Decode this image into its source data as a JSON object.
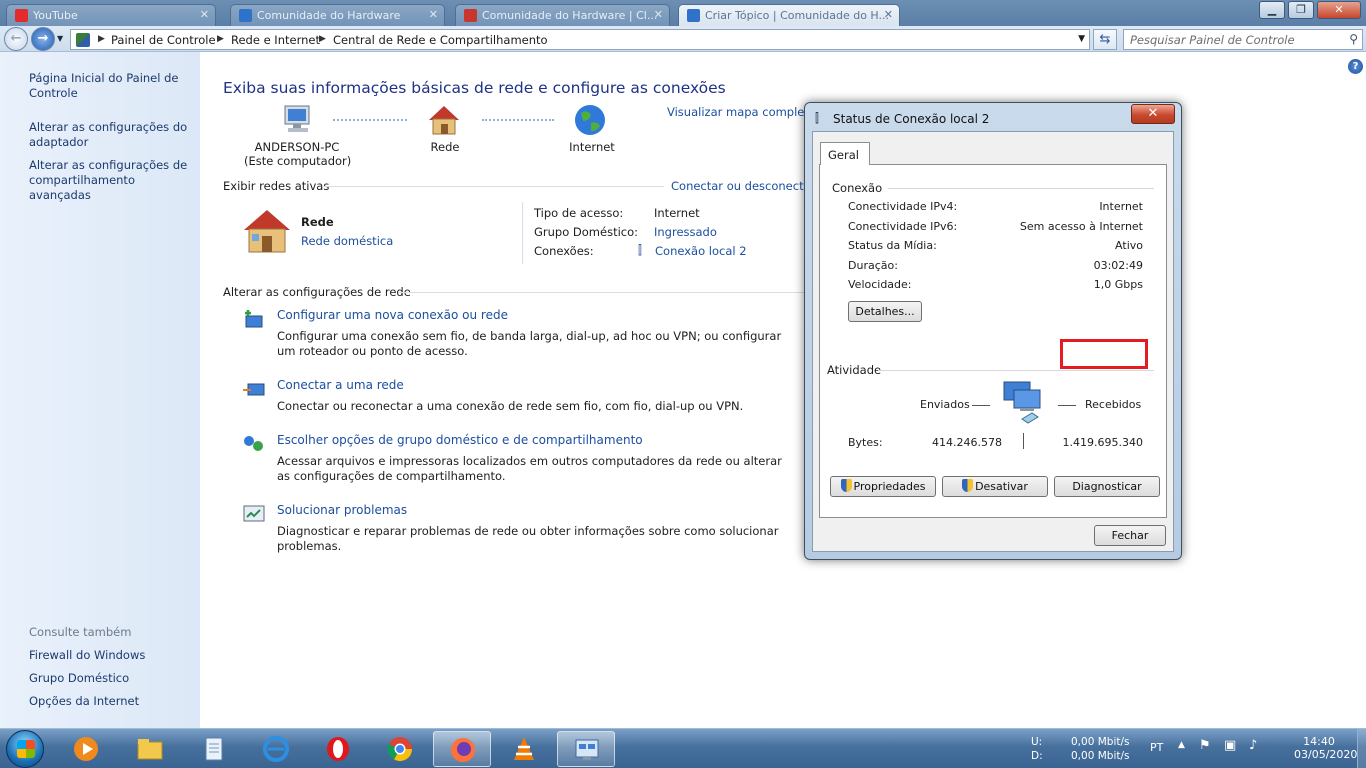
{
  "browser_tabs": [
    {
      "title": "YouTube",
      "icon_color": "#e32b2b"
    },
    {
      "title": "Comunidade do Hardware",
      "icon_color": "#2e72c9"
    },
    {
      "title": "Comunidade do Hardware | Cl...",
      "icon_color": "#c9362e"
    },
    {
      "title": "Criar Tópico | Comunidade do H...",
      "icon_color": "#2e72c9"
    }
  ],
  "address": {
    "breadcrumbs": [
      "Painel de Controle",
      "Rede e Internet",
      "Central de Rede e Compartilhamento"
    ],
    "search_placeholder": "Pesquisar Painel de Controle"
  },
  "left_pane": {
    "links": [
      "Página Inicial do Painel de Controle",
      "Alterar as configurações do adaptador",
      "Alterar as configurações de compartilhamento avançadas"
    ],
    "see_also_heading": "Consulte também",
    "see_also": [
      "Firewall do Windows",
      "Grupo Doméstico",
      "Opções da Internet"
    ]
  },
  "main": {
    "title": "Exiba suas informações básicas de rede e configure as conexões",
    "view_full_map": "Visualizar mapa completo",
    "map": {
      "computer_name": "ANDERSON-PC",
      "computer_sub": "(Este computador)",
      "network": "Rede",
      "internet": "Internet"
    },
    "active_networks_heading": "Exibir redes ativas",
    "connect_disconnect": "Conectar ou desconectar",
    "network_name": "Rede",
    "network_type": "Rede doméstica",
    "info": {
      "access_type_label": "Tipo de acesso:",
      "access_type_value": "Internet",
      "homegroup_label": "Grupo Doméstico:",
      "homegroup_value": "Ingressado",
      "connections_label": "Conexões:",
      "connections_value": "Conexão local 2"
    },
    "change_settings_heading": "Alterar as configurações de rede",
    "tasks": [
      {
        "title": "Configurar uma nova conexão ou rede",
        "desc": "Configurar uma conexão sem fio, de banda larga, dial-up, ad hoc ou VPN; ou configurar um roteador ou ponto de acesso."
      },
      {
        "title": "Conectar a uma rede",
        "desc": "Conectar ou reconectar a uma conexão de rede sem fio, com fio, dial-up ou VPN."
      },
      {
        "title": "Escolher opções de grupo doméstico e de compartilhamento",
        "desc": "Acessar arquivos e impressoras localizados em outros computadores da rede ou alterar as configurações de compartilhamento."
      },
      {
        "title": "Solucionar problemas",
        "desc": "Diagnosticar e reparar problemas de rede ou obter informações sobre como solucionar problemas."
      }
    ]
  },
  "dialog": {
    "title": "Status de Conexão local 2",
    "tab": "Geral",
    "connection_heading": "Conexão",
    "rows": [
      {
        "label": "Conectividade IPv4:",
        "value": "Internet"
      },
      {
        "label": "Conectividade IPv6:",
        "value": "Sem acesso à Internet"
      },
      {
        "label": "Status da Mídia:",
        "value": "Ativo"
      },
      {
        "label": "Duração:",
        "value": "03:02:49"
      },
      {
        "label": "Velocidade:",
        "value": "1,0 Gbps"
      }
    ],
    "details_button": "Detalhes...",
    "activity_heading": "Atividade",
    "sent_label": "Enviados",
    "received_label": "Recebidos",
    "bytes_label": "Bytes:",
    "bytes_sent": "414.246.578",
    "bytes_received": "1.419.695.340",
    "properties_button": "Propriedades",
    "disable_button": "Desativar",
    "diagnose_button": "Diagnosticar",
    "close_button": "Fechar",
    "highlight_color": "#e31b23"
  },
  "taskbar": {
    "apps": [
      "windows-media-player",
      "windows-explorer",
      "notepad",
      "internet-explorer",
      "opera",
      "chrome",
      "firefox",
      "vlc",
      "network-center"
    ],
    "net_upload_label": "U:",
    "net_upload": "0,00 Mbit/s",
    "net_download_label": "D:",
    "net_download": "0,00 Mbit/s",
    "language": "PT",
    "time": "14:40",
    "date": "03/05/2020"
  }
}
